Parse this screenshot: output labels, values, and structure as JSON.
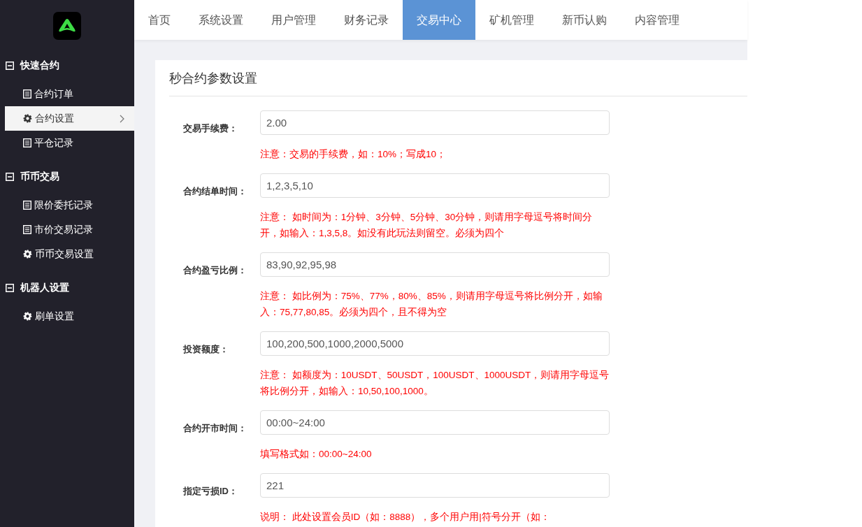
{
  "nav": [
    {
      "label": "首页",
      "selected": false
    },
    {
      "label": "系统设置",
      "selected": false
    },
    {
      "label": "用户管理",
      "selected": false
    },
    {
      "label": "财务记录",
      "selected": false
    },
    {
      "label": "交易中心",
      "selected": true
    },
    {
      "label": "矿机管理",
      "selected": false
    },
    {
      "label": "新币认购",
      "selected": false
    },
    {
      "label": "内容管理",
      "selected": false
    }
  ],
  "sidebar": {
    "groups": [
      {
        "label": "快速合约",
        "expanded": true,
        "items": [
          {
            "label": "合约订单",
            "kind": "list",
            "selected": false
          },
          {
            "label": "合约设置",
            "kind": "gear",
            "selected": true
          },
          {
            "label": "平仓记录",
            "kind": "list",
            "selected": false
          }
        ]
      },
      {
        "label": "币币交易",
        "expanded": true,
        "items": [
          {
            "label": "限价委托记录",
            "kind": "list",
            "selected": false
          },
          {
            "label": "市价交易记录",
            "kind": "list",
            "selected": false
          },
          {
            "label": "币币交易设置",
            "kind": "gear",
            "selected": false
          }
        ]
      },
      {
        "label": "机器人设置",
        "expanded": true,
        "items": [
          {
            "label": "刷单设置",
            "kind": "gear",
            "selected": false
          }
        ]
      }
    ]
  },
  "panel": {
    "title": "秒合约参数设置",
    "fields": [
      {
        "label": "交易手续费：",
        "value": "2.00",
        "note": "注意：交易的手续费，如：10%；写成10；"
      },
      {
        "label": "合约结单时间：",
        "value": "1,2,3,5,10",
        "note": "注意： 如时间为：1分钟、3分钟、5分钟、30分钟，则请用字母逗号将时间分开，如输入：1,3,5,8。如没有此玩法则留空。必须为四个"
      },
      {
        "label": "合约盈亏比例：",
        "value": "83,90,92,95,98",
        "note": "注意： 如比例为：75%、77%，80%、85%，则请用字母逗号将比例分开，如输入：75,77,80,85。必须为四个，且不得为空"
      },
      {
        "label": "投资额度：",
        "value": "100,200,500,1000,2000,5000",
        "note": "注意： 如额度为：10USDT、50USDT，100USDT、1000USDT，则请用字母逗号将比例分开，如输入：10,50,100,1000。"
      },
      {
        "label": "合约开市时间：",
        "value": "00:00~24:00",
        "note": "填写格式如：00:00~24:00"
      },
      {
        "label": "指定亏损ID：",
        "value": "221",
        "note": "说明： 此处设置会员ID（如：8888），多个用户用|符号分开（如："
      }
    ]
  }
}
